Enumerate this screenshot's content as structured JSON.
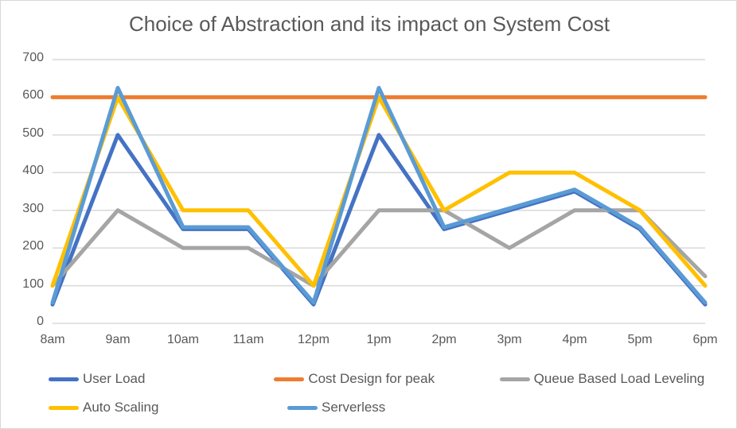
{
  "chart_data": {
    "type": "line",
    "title": "Choice of Abstraction and its impact on System Cost",
    "xlabel": "",
    "ylabel": "",
    "categories": [
      "8am",
      "9am",
      "10am",
      "11am",
      "12pm",
      "1pm",
      "2pm",
      "3pm",
      "4pm",
      "5pm",
      "6pm"
    ],
    "ylim": [
      0,
      700
    ],
    "ytick_values": [
      0,
      100,
      200,
      300,
      400,
      500,
      600,
      700
    ],
    "ytick_labels": [
      "0",
      "100",
      "200",
      "300",
      "400",
      "500",
      "600",
      "700"
    ],
    "grid": "horizontal",
    "legend_position": "bottom",
    "series": [
      {
        "name": "User Load",
        "color": "#4472C4",
        "values": [
          50,
          500,
          250,
          250,
          50,
          500,
          250,
          300,
          350,
          250,
          50
        ]
      },
      {
        "name": "Cost Design for peak",
        "color": "#ED7D31",
        "values": [
          600,
          600,
          600,
          600,
          600,
          600,
          600,
          600,
          600,
          600,
          600
        ]
      },
      {
        "name": "Queue Based Load Leveling",
        "color": "#A5A5A5",
        "values": [
          100,
          300,
          200,
          200,
          100,
          300,
          300,
          200,
          300,
          300,
          125
        ]
      },
      {
        "name": "Auto Scaling",
        "color": "#FFC000",
        "values": [
          100,
          600,
          300,
          300,
          100,
          600,
          300,
          400,
          400,
          300,
          100
        ]
      },
      {
        "name": "Serverless",
        "color": "#5B9BD5",
        "values": [
          55,
          625,
          255,
          255,
          55,
          625,
          255,
          305,
          355,
          255,
          55
        ]
      }
    ]
  },
  "legend": {
    "items": [
      {
        "label": "User Load",
        "color": "#4472C4"
      },
      {
        "label": "Cost Design for peak",
        "color": "#ED7D31"
      },
      {
        "label": "Queue Based Load Leveling",
        "color": "#A5A5A5"
      },
      {
        "label": "Auto Scaling",
        "color": "#FFC000"
      },
      {
        "label": "Serverless",
        "color": "#5B9BD5"
      }
    ]
  },
  "axes": {
    "gridline_color": "#D9D9D9",
    "tick_text_color": "#595959"
  }
}
